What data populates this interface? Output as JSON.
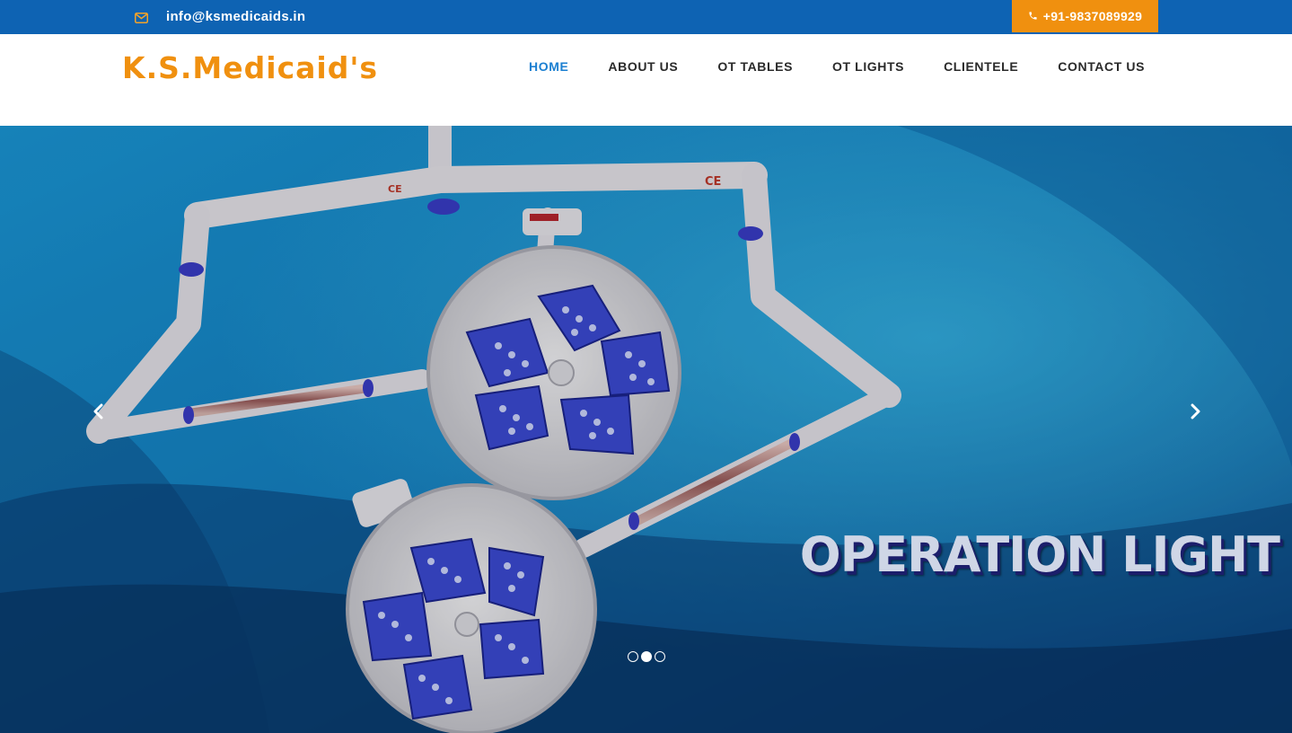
{
  "topbar": {
    "email": "info@ksmedicaids.in",
    "email_icon": "envelope-icon",
    "phone": "+91-9837089929",
    "phone_icon": "phone-icon",
    "background_color": "#0e63b3",
    "phone_background": "#f0900f"
  },
  "header": {
    "logo_text": "K.S.Medicaid's",
    "logo_color": "#f0900f"
  },
  "nav": {
    "items": [
      {
        "label": "HOME",
        "active": true
      },
      {
        "label": "ABOUT US",
        "active": false
      },
      {
        "label": "OT TABLES",
        "active": false
      },
      {
        "label": "OT LIGHTS",
        "active": false
      },
      {
        "label": "CLIENTELE",
        "active": false
      },
      {
        "label": "CONTACT US",
        "active": false
      }
    ],
    "active_color": "#1b7fd1"
  },
  "carousel": {
    "caption": "OPERATION LIGHT",
    "slide_count": 3,
    "active_slide": 2,
    "prev_icon": "chevron-left-icon",
    "next_icon": "chevron-right-icon",
    "image": "operation-light-image"
  }
}
